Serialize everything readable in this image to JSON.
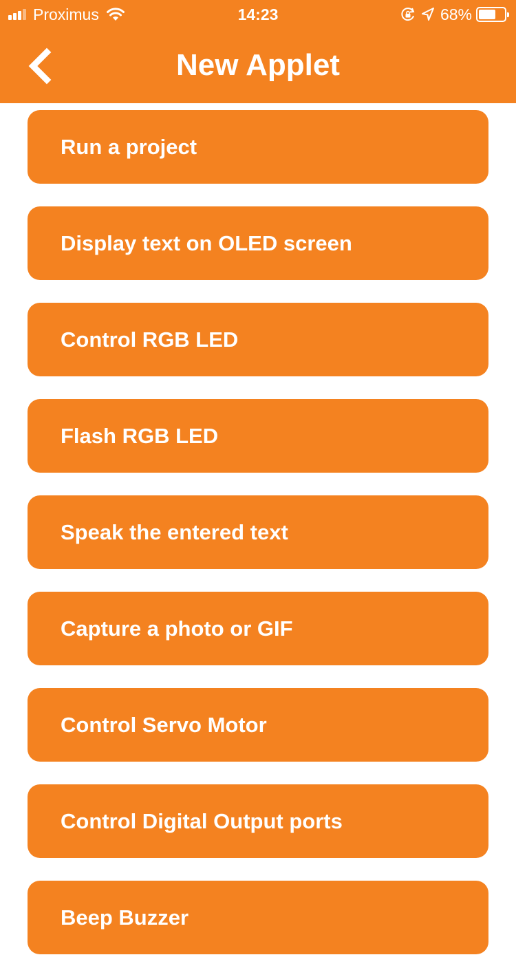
{
  "status_bar": {
    "carrier": "Proximus",
    "time": "14:23",
    "battery_percent": "68%",
    "battery_level": 0.68,
    "signal_bars": 3,
    "icons": [
      "signal-icon",
      "wifi-icon",
      "orientation-lock-icon",
      "location-icon",
      "battery-icon"
    ]
  },
  "header": {
    "title": "New Applet",
    "back_icon": "chevron-left-icon",
    "background_color": "#f48220"
  },
  "applets": [
    {
      "label": "Run a project"
    },
    {
      "label": "Display text on OLED screen"
    },
    {
      "label": "Control RGB LED"
    },
    {
      "label": "Flash RGB LED"
    },
    {
      "label": "Speak the entered text"
    },
    {
      "label": "Capture a photo or GIF"
    },
    {
      "label": "Control Servo Motor"
    },
    {
      "label": "Control Digital Output ports"
    },
    {
      "label": "Beep Buzzer"
    }
  ],
  "colors": {
    "accent": "#f48220",
    "text_on_accent": "#ffffff",
    "background": "#ffffff"
  }
}
